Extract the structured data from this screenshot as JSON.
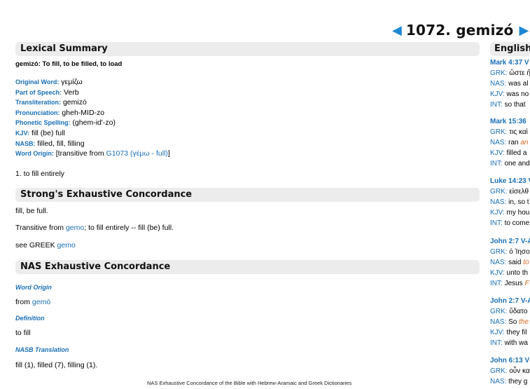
{
  "header": {
    "prev_arrow": "◀",
    "title": "1072. gemizó",
    "next_arrow": "▶"
  },
  "lexical": {
    "heading": "Lexical Summary",
    "summary": "gemizó: To fill, to be filled, to load",
    "fields": [
      {
        "label": "Original Word:",
        "value": "γεμίζω"
      },
      {
        "label": "Part of Speech:",
        "value": "Verb"
      },
      {
        "label": "Transliteration:",
        "value": "gemizó"
      },
      {
        "label": "Pronunciation:",
        "value": "gheh-MID-zo"
      },
      {
        "label": "Phonetic Spelling:",
        "value": "(ghem-id'-zo)"
      },
      {
        "label": "KJV:",
        "value": "fill (be) full"
      },
      {
        "label": "NASB:",
        "value": "filled, fill, filling"
      }
    ],
    "origin_label": "Word Origin:",
    "origin_prefix": "[transitive from",
    "origin_link": "G1073 (γέμω - full)",
    "origin_suffix": "]",
    "definition": "1. to fill entirely"
  },
  "strongs": {
    "heading": "Strong's Exhaustive Concordance",
    "line1": "fill, be full.",
    "line2_prefix": "Transitive from",
    "line2_link": "gemo",
    "line2_suffix": "; to fill entirely -- fill (be) full.",
    "line3_prefix": "see GREEK",
    "line3_link": "gemo"
  },
  "nas": {
    "heading": "NAS Exhaustive Concordance",
    "word_origin_label": "Word Origin",
    "from_prefix": "from",
    "from_link": "gemó",
    "definition_label": "Definition",
    "definition": "to fill",
    "translation_label": "NASB Translation",
    "translation": "fill (1), filled (7), filling (1)."
  },
  "footer": "NAS Exhaustive Concordance of the Bible with Hebrew-Aramaic and Greek Dictionaries",
  "english": {
    "heading": "Englishman's Concordance",
    "entries": [
      {
        "ref": "Mark 4:37 V",
        "grk": "ὥστε ἤ",
        "nas_pre": "was al",
        "nas_hl": "",
        "kjv": "was no",
        "int_pre": "so that",
        "int_hl": ""
      },
      {
        "ref": "Mark 15:36",
        "grk": "τις καὶ",
        "nas_pre": "ran ",
        "nas_hl": "an",
        "kjv": "filled a",
        "int_pre": "one and",
        "int_hl": ""
      },
      {
        "ref": "Luke 14:23 V",
        "grk": "εἰσελθ",
        "nas_pre": "in, so t",
        "nas_hl": "",
        "kjv": "my hou",
        "int_pre": "to come",
        "int_hl": ""
      },
      {
        "ref": "John 2:7 V-A",
        "grk": "ὁ Ἰησο",
        "nas_pre": "said ",
        "nas_hl": "to",
        "kjv": "unto th",
        "int_pre": "Jesus ",
        "int_hl": "F"
      },
      {
        "ref": "John 2:7 V-A",
        "grk": "ὕδατο",
        "nas_pre": "So ",
        "nas_hl": "the",
        "kjv": "they fil",
        "int_pre": "with wa",
        "int_hl": ""
      },
      {
        "ref": "John 6:13 V",
        "grk": "οὖν κα",
        "nas_pre": "they g",
        "nas_hl": "",
        "kjv": "",
        "int_pre": "",
        "int_hl": ""
      }
    ]
  },
  "labels": {
    "grk": "GRK:",
    "nas": "NAS:",
    "kjv": "KJV:",
    "int": "INT:"
  }
}
